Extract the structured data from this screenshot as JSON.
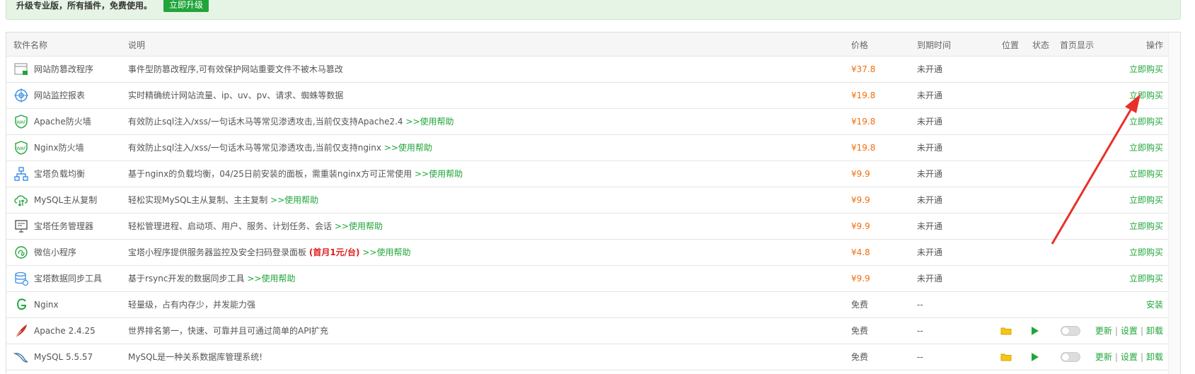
{
  "banner": {
    "text": "升级专业版，所有插件，免费使用。",
    "button": "立即升级"
  },
  "colors": {
    "accent_green": "#20a53a",
    "price_orange": "#f0700f",
    "promo_red": "#e01b1b",
    "arrow_red": "#e8302a"
  },
  "table": {
    "headers": {
      "name": "软件名称",
      "desc": "说明",
      "price": "价格",
      "expire": "到期时间",
      "position": "位置",
      "status": "状态",
      "home": "首页显示",
      "op": "操作"
    },
    "rows": [
      {
        "icon": "tamper-proof-icon",
        "name": "网站防篡改程序",
        "desc": "事件型防篡改程序,可有效保护网站重要文件不被木马篡改",
        "promo": "",
        "help": "",
        "price": "¥37.8",
        "expire": "未开通",
        "op": "立即购买"
      },
      {
        "icon": "monitor-report-icon",
        "name": "网站监控报表",
        "desc": "实时精确统计网站流量、ip、uv、pv、请求、蜘蛛等数据",
        "promo": "",
        "help": "",
        "price": "¥19.8",
        "expire": "未开通",
        "op": "立即购买"
      },
      {
        "icon": "waf-shield-icon",
        "name": "Apache防火墙",
        "desc": "有效防止sql注入/xss/一句话木马等常见渗透攻击,当前仅支持Apache2.4",
        "promo": "",
        "help": ">>使用帮助",
        "price": "¥19.8",
        "expire": "未开通",
        "op": "立即购买"
      },
      {
        "icon": "waf-shield-icon",
        "name": "Nginx防火墙",
        "desc": "有效防止sql注入/xss/一句话木马等常见渗透攻击,当前仅支持nginx",
        "promo": "",
        "help": ">>使用帮助",
        "price": "¥19.8",
        "expire": "未开通",
        "op": "立即购买"
      },
      {
        "icon": "load-balance-icon",
        "name": "宝塔负载均衡",
        "desc": "基于nginx的负载均衡，04/25日前安装的面板，需重装nginx方可正常使用",
        "promo": "",
        "help": ">>使用帮助",
        "price": "¥9.9",
        "expire": "未开通",
        "op": "立即购买"
      },
      {
        "icon": "mysql-sync-icon",
        "name": "MySQL主从复制",
        "desc": "轻松实现MySQL主从复制、主主复制",
        "promo": "",
        "help": ">>使用帮助",
        "price": "¥9.9",
        "expire": "未开通",
        "op": "立即购买"
      },
      {
        "icon": "task-manager-icon",
        "name": "宝塔任务管理器",
        "desc": "轻松管理进程、启动项、用户、服务、计划任务、会话",
        "promo": "",
        "help": ">>使用帮助",
        "price": "¥9.9",
        "expire": "未开通",
        "op": "立即购买"
      },
      {
        "icon": "mini-program-icon",
        "name": "微信小程序",
        "desc": "宝塔小程序提供服务器监控及安全扫码登录面板",
        "promo": "(首月1元/台)",
        "help": ">>使用帮助",
        "price": "¥4.8",
        "expire": "未开通",
        "op": "立即购买"
      },
      {
        "icon": "data-sync-icon",
        "name": "宝塔数据同步工具",
        "desc": "基于rsync开发的数据同步工具",
        "promo": "",
        "help": ">>使用帮助",
        "price": "¥9.9",
        "expire": "未开通",
        "op": "立即购买"
      },
      {
        "icon": "nginx-logo-icon",
        "name": "Nginx",
        "desc": "轻量级，占有内存少，并发能力强",
        "promo": "",
        "help": "",
        "price": "免费",
        "expire": "--",
        "op": "安装"
      },
      {
        "icon": "apache-feather-icon",
        "name": "Apache 2.4.25",
        "desc": "世界排名第一，快速、可靠并且可通过简单的API扩充",
        "promo": "",
        "help": "",
        "price": "免费",
        "expire": "--",
        "op_update": "更新",
        "op_settings": "设置",
        "op_uninstall": "卸载"
      },
      {
        "icon": "mysql-dolphin-icon",
        "name": "MySQL 5.5.57",
        "desc": "MySQL是一种关系数据库管理系统!",
        "promo": "",
        "help": "",
        "price": "免费",
        "expire": "--",
        "op_update": "更新",
        "op_settings": "设置",
        "op_uninstall": "卸载"
      }
    ]
  }
}
